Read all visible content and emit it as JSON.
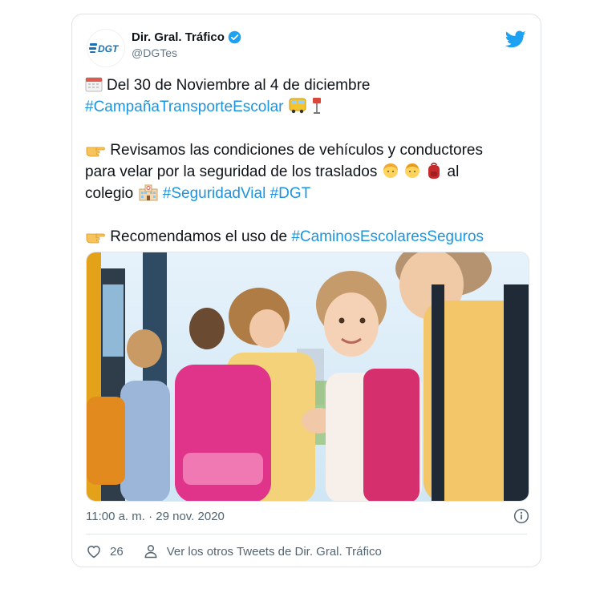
{
  "tweet": {
    "display_name": "Dir. Gral. Tráfico",
    "handle": "@DGTes",
    "avatar_text": "DGT",
    "line1": "Del 30 de Noviembre al 4 de diciembre",
    "hashtag_campaign": "#CampañaTransporteEscolar",
    "line2a": "Revisamos las condiciones de vehículos y conductores",
    "line2b": "para velar por la seguridad de los traslados",
    "line2c_pre": "al",
    "line2d": "colegio",
    "hashtag_vial": "#SeguridadVial",
    "hashtag_dgt": "#DGT",
    "line3": "Recomendamos el uso de",
    "hashtag_caminos": "#CaminosEscolaresSeguros",
    "timestamp": "11:00 a. m. · 29 nov. 2020",
    "likes": "26",
    "see_more": "Ver los otros Tweets de Dir. Gral. Tráfico"
  },
  "colors": {
    "hashtag": "#1b95e0",
    "twitter_blue": "#1da1f2",
    "pink_backpack": "#e0338a"
  },
  "icons": [
    "calendar-icon",
    "school-bus-icon",
    "bus-stop-icon",
    "pointing-hand-icon",
    "child-girl-icon",
    "child-boy-icon",
    "backpack-icon",
    "school-icon",
    "verified-badge-icon",
    "twitter-bird-icon",
    "info-icon",
    "heart-icon",
    "person-icon"
  ]
}
